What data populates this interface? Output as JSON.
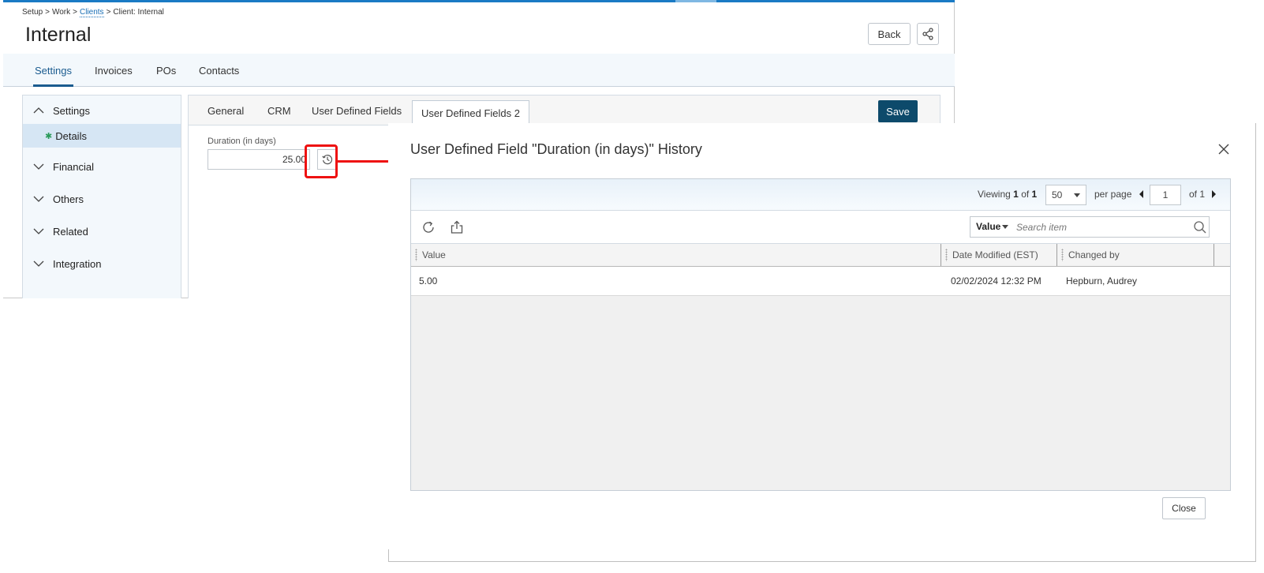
{
  "app": {
    "breadcrumb": [
      {
        "label": "Setup",
        "link": false
      },
      {
        "label": "Work",
        "link": false
      },
      {
        "label": "Clients",
        "link": true
      },
      {
        "label": "Client: Internal",
        "link": false
      }
    ],
    "title": "Internal",
    "back_label": "Back",
    "share_icon": "share-icon",
    "tabs": [
      {
        "label": "Settings",
        "active": true
      },
      {
        "label": "Invoices",
        "active": false
      },
      {
        "label": "POs",
        "active": false
      },
      {
        "label": "Contacts",
        "active": false
      }
    ],
    "nav": [
      {
        "label": "Settings",
        "expanded": true,
        "children": [
          "Details"
        ]
      },
      {
        "label": "Financial",
        "expanded": false
      },
      {
        "label": "Others",
        "expanded": false
      },
      {
        "label": "Related",
        "expanded": false
      },
      {
        "label": "Integration",
        "expanded": false
      }
    ],
    "sub_tabs": [
      {
        "label": "General",
        "active": false
      },
      {
        "label": "CRM",
        "active": false
      },
      {
        "label": "User Defined Fields",
        "active": false
      },
      {
        "label": "User Defined Fields 2",
        "active": true
      }
    ],
    "save_label": "Save",
    "field": {
      "label": "Duration (in days)",
      "value": "25.00"
    },
    "history_icon": "history-icon",
    "colors": {
      "accent": "#1a5b8f",
      "save_bg": "#0d4a6b",
      "highlight": "#ee1111",
      "top_bar": "#1a7ac4"
    }
  },
  "dialog": {
    "title": "User Defined Field \"Duration (in days)\" History",
    "pager": {
      "viewing_prefix": "Viewing",
      "viewing_from": "1",
      "viewing_of": "of",
      "viewing_total": "1",
      "per_page_value": "50",
      "per_page_label": "per page",
      "page_value": "1",
      "of_pages": "of 1"
    },
    "search": {
      "field": "Value",
      "placeholder": "Search item"
    },
    "columns": [
      "Value",
      "Date Modified (EST)",
      "Changed by"
    ],
    "rows": [
      {
        "value": "5.00",
        "date_modified": "02/02/2024 12:32 PM",
        "changed_by": "Hepburn, Audrey"
      }
    ],
    "close_label": "Close"
  }
}
